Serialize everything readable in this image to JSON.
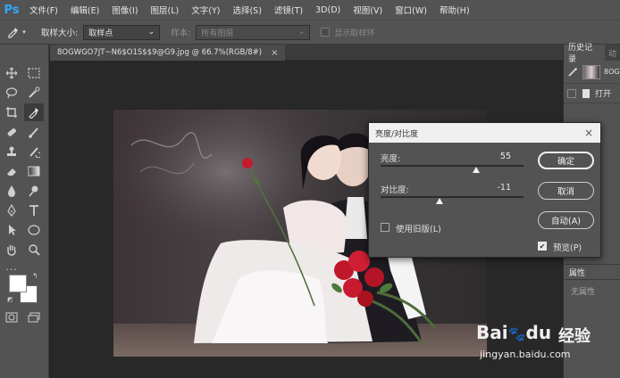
{
  "app": {
    "logo": "Ps"
  },
  "menu": [
    "文件(F)",
    "编辑(E)",
    "图像(I)",
    "图层(L)",
    "文字(Y)",
    "选择(S)",
    "滤镜(T)",
    "3D(D)",
    "视图(V)",
    "窗口(W)",
    "帮助(H)"
  ],
  "options": {
    "sample_size_label": "取样大小:",
    "sample_size_value": "取样点",
    "sample_label": "样本:",
    "sample_value": "所有图层",
    "show_ring_label": "显示取样环"
  },
  "document": {
    "tab_title": "8OGWGO7JT~N6$O1S$$9@G9.jpg @ 66.7%(RGB/8#)",
    "close_glyph": "×"
  },
  "right_panel": {
    "tab_history": "历史记录",
    "tab_other": "动",
    "history_items": [
      {
        "label": "8OG"
      },
      {
        "label": "打开"
      }
    ],
    "properties_tab": "属性",
    "no_properties": "无属性"
  },
  "dialog": {
    "title": "亮度/对比度",
    "close_glyph": "×",
    "brightness_label": "亮度:",
    "brightness_value": "55",
    "brightness_fraction": 0.67,
    "contrast_label": "对比度:",
    "contrast_value": "-11",
    "contrast_fraction": 0.41,
    "use_legacy_label": "使用旧版(L)",
    "use_legacy_checked": false,
    "ok_label": "确定",
    "cancel_label": "取消",
    "auto_label": "自动(A)",
    "preview_label": "预览(P)",
    "preview_checked": true
  },
  "watermark": {
    "brand": "Bai",
    "brand_suffix": "du",
    "product": "经验",
    "url": "jingyan.baidu.com"
  },
  "colors": {
    "ui_dark": "#535353",
    "canvas_bg": "#282828",
    "ps_blue": "#31a8ff",
    "dialog_title_bg": "#f0f0f0"
  },
  "icons": [
    "eyedropper-icon",
    "move-icon",
    "marquee-icon",
    "lasso-icon",
    "quick-select-icon",
    "crop-icon",
    "healing-icon",
    "brush-icon",
    "stamp-icon",
    "history-brush-icon",
    "eraser-icon",
    "gradient-icon",
    "blur-icon",
    "dodge-icon",
    "pen-icon",
    "type-icon",
    "path-select-icon",
    "shape-icon",
    "hand-icon",
    "zoom-icon",
    "more-icon"
  ]
}
